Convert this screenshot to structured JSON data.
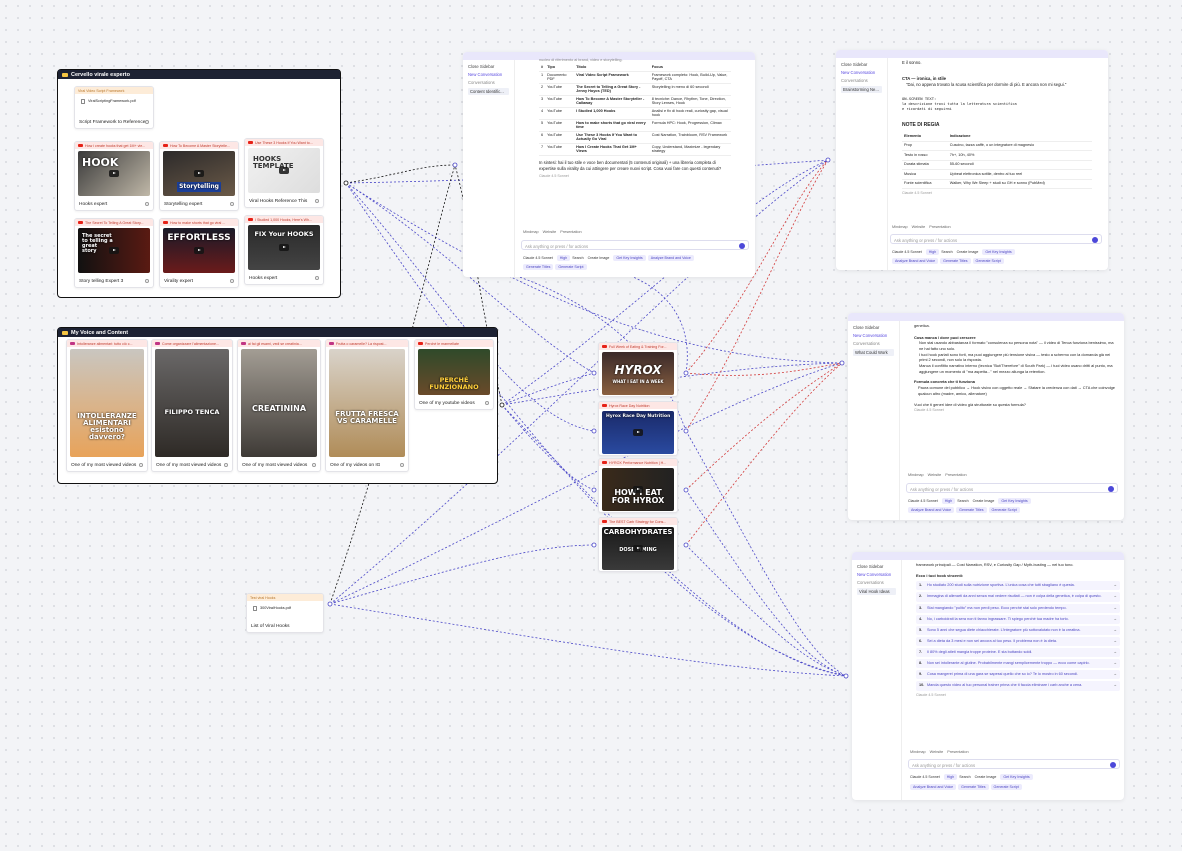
{
  "groups": {
    "g1": "Cervello virale esperto",
    "g2": "My Voice and Content"
  },
  "pdf_cards": {
    "script_fw": {
      "header": "Viral Video Script Framework",
      "file": "ViralScriptingFramework.pdf",
      "caption": "Script Framework to Reference"
    },
    "list_hooks": {
      "header": "Test viral Hooks",
      "file": "300ViralHooks.pdf",
      "caption": "List of Viral Hooks"
    }
  },
  "video_cards": [
    {
      "header": "How i create hooks that get 1M+ vie...",
      "caption": "Hooks expert",
      "title": "HOOK"
    },
    {
      "header": "How To Become A Master Storytelle...",
      "caption": "Storytelling expert",
      "title": "Storytelling"
    },
    {
      "header": "Use These 3 Hooks If You Want to...",
      "caption": "Viral Hooks Reference This",
      "title": "HOOKS TEMPLATE"
    },
    {
      "header": "The Secret To Telling A Great Story...",
      "caption": "Story telling Expert 3",
      "title": "The secret to telling a great story"
    },
    {
      "header": "How to make shorts that go viral ...",
      "caption": "Virality expert",
      "title": "EFFORTLESS"
    },
    {
      "header": "I Studied 1,000 Hooks, Here's Wh...",
      "caption": "Hooks expert",
      "title": "FIX Your HOOKS"
    }
  ],
  "voice_cards": [
    {
      "header": "Intolleranze alimentari: tutto ciò c...",
      "caption": "One of my most viewed videos",
      "title": "INTOLLERANZE ALIMENTARI esistono davvero?"
    },
    {
      "header": "Come organizzare l'alimentazione...",
      "caption": "One of my most viewed videos",
      "title": "FILIPPO TENCA"
    },
    {
      "header": "ai fai gli esami, vedi se creatinia...",
      "caption": "One of my most viewed videos",
      "title": "CREATININA"
    },
    {
      "header": "Frutta o caramelle? La rispost...",
      "caption": "One of my videos on IG",
      "title": "FRUTTA FRESCA VS CARAMELLE"
    },
    {
      "header": "Perché le marmellate",
      "caption": "One of my youtube videos",
      "title": "PERCHÉ FUNZIONANO"
    }
  ],
  "center_cards": [
    {
      "header": "Full Week of Eating & Training For...",
      "title": "HYROX",
      "sub": "WHAT I EAT IN A WEEK"
    },
    {
      "header": "Hyrox Race Day Nutrition",
      "title": "Hyrox Race Day Nutrition"
    },
    {
      "header": "HYROX Performance Nutrition | H...",
      "title": "HOW I EAT FOR HYROX"
    },
    {
      "header": "The BEST Carb Strategy for Cons...",
      "title": "CARBOHYDRATES",
      "sub": "DOSE TIMING"
    }
  ],
  "chat1": {
    "sidebar": {
      "close": "Close Sidebar",
      "new": "New Conversation",
      "conv": "Conversations",
      "item": "Content Identific..."
    },
    "intro": "nucleo di riferimento ai brand, video e storytelling.",
    "cols": [
      "#",
      "Tipo",
      "Titolo",
      "Focus"
    ],
    "rows": [
      [
        "1",
        "Documento PDF",
        "Viral Video Script Framework",
        "Framework completo: Hook, Build-Up, Value, Payoff, CTA"
      ],
      [
        "2",
        "YouTube",
        "The Secret to Telling a Great Story - Jenny Hoyos (TED)",
        "Storytelling in meno di 60 secondi"
      ],
      [
        "3",
        "YouTube",
        "How To Become A Master Storyteller - Callaway",
        "8 tecniche: Dance, Rhythm, Tone, Direction, Story Lenses, Hook"
      ],
      [
        "4",
        "YouTube",
        "I Studied 1,000 Hooks",
        "Analisi e fix di hook reali, curiosity gap, visual hook"
      ],
      [
        "5",
        "YouTube",
        "How to make shorts that go viral every time",
        "Formula HPC: Hook, Progression, Climax"
      ],
      [
        "6",
        "YouTube",
        "Use These 3 Hooks If You Want to Actually Go Viral",
        "Cost Narration, Trainbloom, RSV Framework"
      ],
      [
        "7",
        "YouTube",
        "How I Create Hooks That Get 1M+ Views",
        "Copy, Understand, Maximize - legendary strategy"
      ]
    ],
    "summary": "In sintesi: hai il tuo stile e voce ben documentati (5 contenuti originali) + una libreria completa di expertise sulla virality da cui attingere per creare nuovi script. Cosa vuoi fare con questi contenuti?",
    "model": "Claude 4.5 Sonnet"
  },
  "chat2": {
    "sidebar": {
      "close": "Close Sidebar",
      "new": "New Conversation",
      "conv": "Conversations",
      "item": "Brainstorming Ne..."
    },
    "line0": "E il sonno.",
    "cta_label": "CTA — ironica, in stile",
    "cta_text": "\"Dai, no appena trovato la scusa scientifica per dormire di più. E ancora non mi segui.\"",
    "ost_label": "ON-SCREEN TEXT:",
    "ost1": "la descrizione trovi tutta la letteratura scientifica",
    "ost2": "e ricordati di seguirmi",
    "regia": "NOTE DI REGIA",
    "cols": [
      "Elemento",
      "Indicazione"
    ],
    "rows": [
      [
        "Prop",
        "Cuscino, tazza caffè, o un integratore di magnesio"
      ],
      [
        "Testo in rosso",
        "7h+, 10h, 40%"
      ],
      [
        "Durata stimata",
        "55-60 secondi"
      ],
      [
        "Musica",
        "Upbeat elettronica sottile, dentro al tuo reel"
      ],
      [
        "Fonte scientifica",
        "Walker, Why We Sleep + studi su GH e sonno (PubMed)"
      ]
    ],
    "model": "Claude 4.5 Sonnet"
  },
  "chat3": {
    "sidebar": {
      "close": "Close Sidebar",
      "new": "New Conversation",
      "conv": "Conversations",
      "item": "What Could Work"
    },
    "line0": "genetica.",
    "h1": "Cosa manca / dove puoi crescere",
    "b1": "Non stai usando abbastanza il formato \"consulenza su persona nota\" — il video di Tenca funziona benissimo, ma ne hai fatto uno solo.",
    "b2": "I tuoi hook parlati sono forti, ma puoi aggiungere più tensione visiva — testo a schermo con la domanda già nei primi 2 secondi, non solo la risposta.",
    "b3": "Manca il conflitto narrativo interno (tecnica \"But/Therefore\" di South Park) — i tuoi video usano dritti al punto, ma aggiungere un momento di \"ma aspetta...\" nel mezzo allunga la retention.",
    "h2": "Formula concreta che ti funziona",
    "f1": "Paura comune del pubblico → Hook visivo con oggetto reale → Sfatare la credenza con dati → CTA che coinvolge qualcun altro (madre, amico, allenatore)",
    "q": "Vuoi che ti generi idee di video già strutturate su questa formula?",
    "model": "Claude 4.5 Sonnet"
  },
  "chat4": {
    "sidebar": {
      "close": "Close Sidebar",
      "new": "New Conversation",
      "conv": "Conversations",
      "item": "Viral Hook Ideas"
    },
    "line0": "framework principali — Cost Narration, RSV, e Curiosity Gap / Myth-busting — nel tuo tono.",
    "h1": "Ecco i tuoi hook vincenti:",
    "hooks": [
      "Ho studiato 200 studi sulla nutrizione sportiva. L'unica cosa che tutti sbagliano è questa.",
      "Immagina di allenarti da anni senza mai vedere risultati — non è colpa della genetica, è colpa di questo.",
      "Stai mangiando \"pulito\" ma non perdi peso. Ecco perché stai solo perdendo tempo.",
      "No, i carboidrati la sera non ti fanno ingrassare. Ti spiego perché tua madre ha torto.",
      "Sono 5 anni che segua diete chiacchierate. L'integratore più sottovalutato non è la creatina.",
      "Sei a dieta da 3 mesi e non sei ancora al tuo peso. Il problema non è la dieta.",
      "Il 80% degli atleti mangia troppe proteine. E sta buttando soldi.",
      "Non sei intollerante al glutine. Probabilmente mangi semplicemente troppo — ecco come capirlo.",
      "Cosa mangerei prima di una gara se sapessi quello che so io? Te lo mostro in 60 secondi.",
      "Manda questo video al tuo personal trainer prima che ti faccia eliminare i carb anche a cena."
    ],
    "model": "Claude 4.5 Sonnet"
  },
  "chat_common": {
    "actions": [
      "Mindmap",
      "Website",
      "Presentation"
    ],
    "placeholder": "Ask anything or press / for actions",
    "model": "Claude 4.5 Sonnet",
    "high": "High",
    "tools": [
      "Search",
      "Create Image"
    ],
    "pills": [
      "Get Key Insights",
      "Analyze Brand and Voice",
      "Generate Titles",
      "Generate Script"
    ]
  },
  "colors": {
    "accent": "#4c48d9",
    "youtube": "#e62117",
    "wire_blue": "#4b48c8",
    "wire_red": "#d23b3b",
    "wire_black": "#111"
  }
}
